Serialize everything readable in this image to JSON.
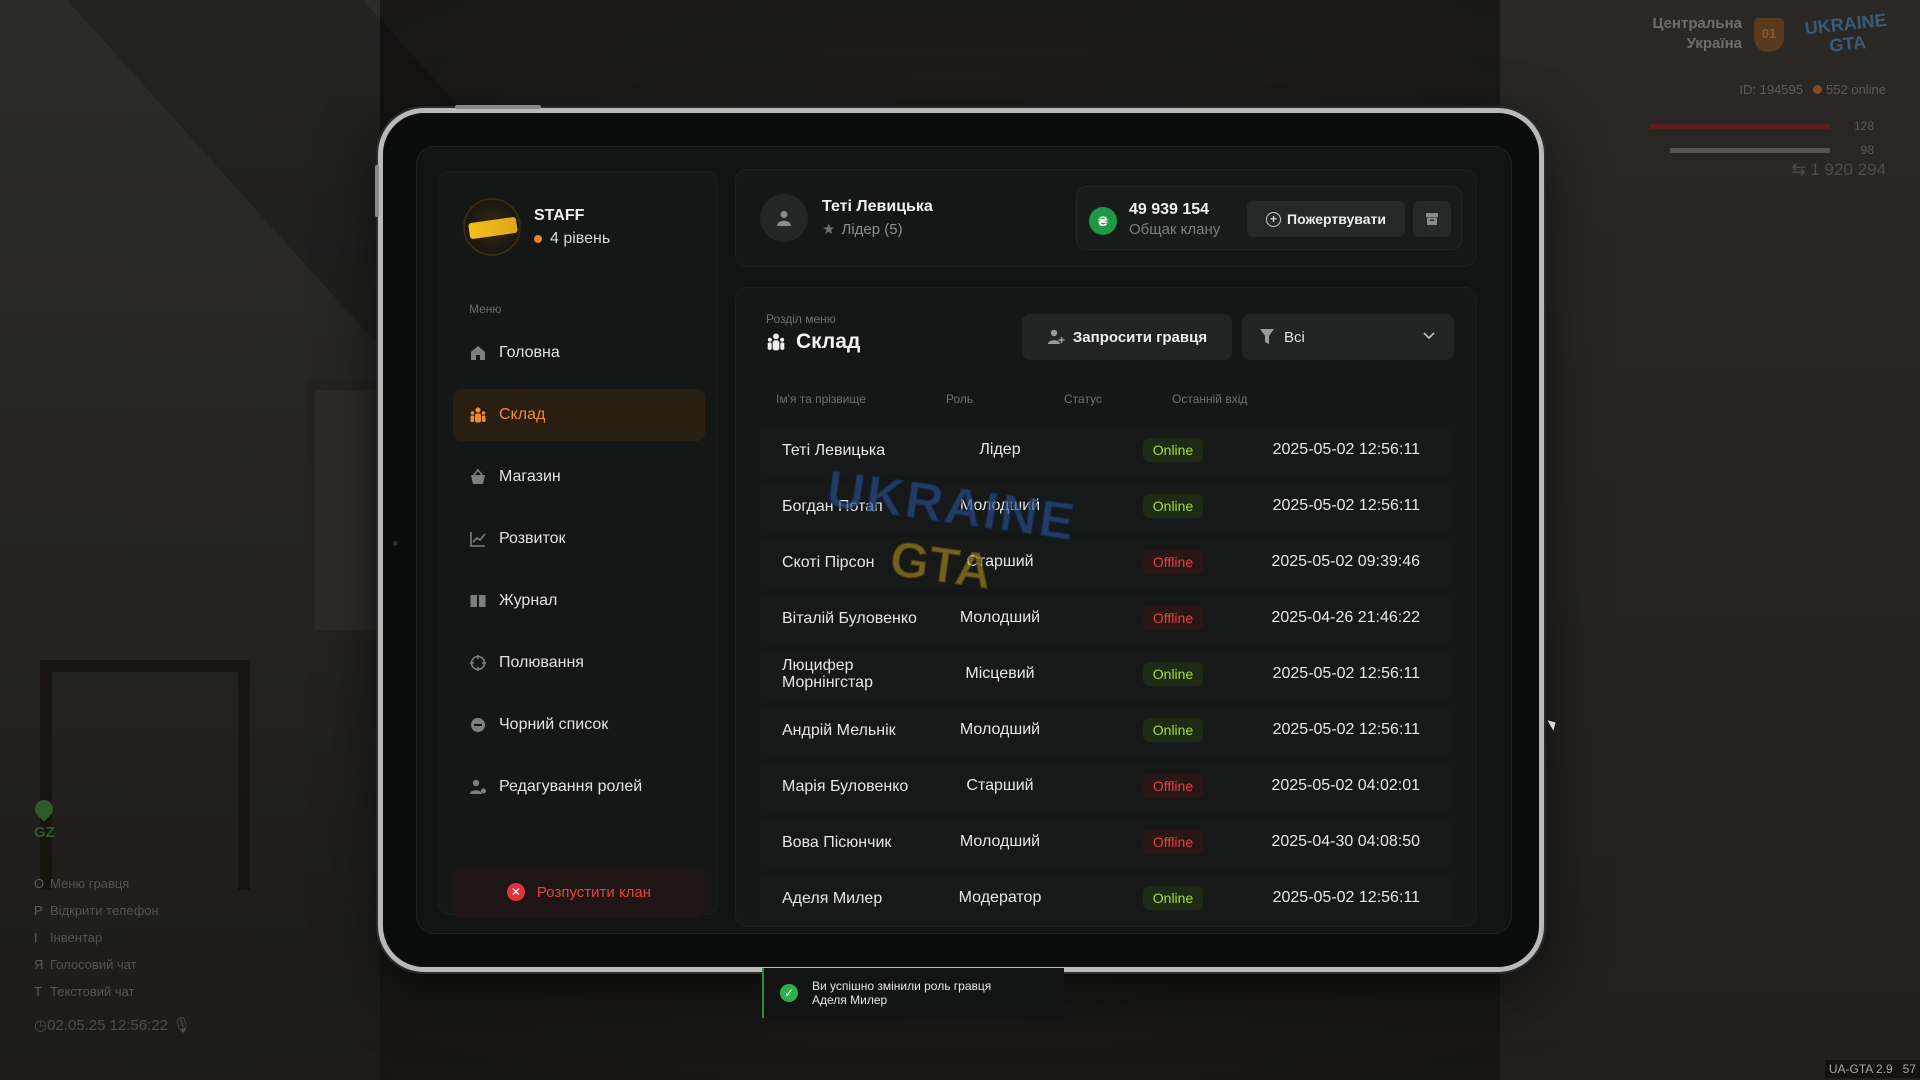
{
  "hud": {
    "region_line1": "Центральна",
    "region_line2": "Україна",
    "region_badge": "01",
    "server_logo_line1": "UKRAINE",
    "server_logo_line2": "GTA",
    "player_id": "ID: 194595",
    "online": "552 online",
    "health": "128",
    "armor": "98",
    "money": "1 920 294",
    "gz_label": "GZ",
    "keys": [
      {
        "key": "O",
        "label": "Меню гравця"
      },
      {
        "key": "P",
        "label": "Відкрити телефон"
      },
      {
        "key": "I",
        "label": "Інвентар"
      },
      {
        "key": "Я",
        "label": "Голосовий чат"
      },
      {
        "key": "T",
        "label": "Текстовий чат"
      }
    ],
    "datetime": "02.05.25 12:56:22",
    "version": "UA-GTA 2.9",
    "fps": "57"
  },
  "clan": {
    "name": "STAFF",
    "level": "4 рівень"
  },
  "sidebar": {
    "caption": "Меню",
    "items": [
      {
        "label": "Головна",
        "icon": "home-icon"
      },
      {
        "label": "Склад",
        "icon": "people-icon",
        "active": true
      },
      {
        "label": "Магазин",
        "icon": "basket-icon"
      },
      {
        "label": "Розвиток",
        "icon": "chart-icon"
      },
      {
        "label": "Журнал",
        "icon": "book-icon"
      },
      {
        "label": "Полювання",
        "icon": "crosshair-icon"
      },
      {
        "label": "Чорний список",
        "icon": "minus-circle-icon"
      },
      {
        "label": "Редагування ролей",
        "icon": "user-edit-icon"
      }
    ],
    "disband_label": "Розпустити клан"
  },
  "header": {
    "leader_name": "Теті Левицька",
    "leader_role": "Лідер (5)",
    "bank_amount": "49 939 154",
    "bank_label": "Общак клану",
    "bank_currency": "₴",
    "donate_label": "Пожертвувати"
  },
  "section": {
    "caption": "Розділ меню",
    "title": "Склад",
    "invite_label": "Запросити гравця",
    "filter_value": "Всі",
    "columns": [
      "Ім'я та прізвище",
      "Роль",
      "Статус",
      "Останній вхід"
    ],
    "members": [
      {
        "name": "Теті Левицька",
        "role": "Лідер",
        "status": "Online",
        "last": "2025-05-02 12:56:11"
      },
      {
        "name": "Богдан Потап",
        "role": "Молодший",
        "status": "Online",
        "last": "2025-05-02 12:56:11"
      },
      {
        "name": "Скоті Пірсон",
        "role": "Старший",
        "status": "Offline",
        "last": "2025-05-02 09:39:46"
      },
      {
        "name": "Віталій Буловенко",
        "role": "Молодший",
        "status": "Offline",
        "last": "2025-04-26 21:46:22"
      },
      {
        "name": "Люцифер Морнінгстар",
        "role": "Місцевий",
        "status": "Online",
        "last": "2025-05-02 12:56:11"
      },
      {
        "name": "Андрій Мельнік",
        "role": "Молодший",
        "status": "Online",
        "last": "2025-05-02 12:56:11"
      },
      {
        "name": "Марія Буловенко",
        "role": "Старший",
        "status": "Offline",
        "last": "2025-05-02 04:02:01"
      },
      {
        "name": "Вова Пісюнчик",
        "role": "Молодший",
        "status": "Offline",
        "last": "2025-04-30 04:08:50"
      },
      {
        "name": "Аделя Милер",
        "role": "Модератор",
        "status": "Online",
        "last": "2025-05-02 12:56:11"
      }
    ]
  },
  "watermark": {
    "line1": "UKRAINE",
    "line2": "GTA"
  },
  "toast": {
    "line1": "Ви успішно змінили роль гравця",
    "line2": "Аделя Милер"
  }
}
